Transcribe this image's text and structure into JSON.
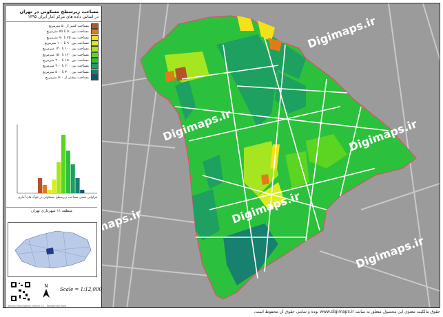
{
  "legend": {
    "title": "مساحت زیرسطح مسکونی در تهران",
    "subtitle": "در اساس داده های مرکز آمار ایران ۱۳۹۵",
    "items": [
      {
        "label": "مساحت کمتر از ۵۰ مترمربع",
        "color": "#b5532b"
      },
      {
        "label": "مساحت بین ۵۰ تا ۷۵ مترمربع",
        "color": "#e07b1a"
      },
      {
        "label": "مساحت بین ۷۵ تا ۹۰ مترمربع",
        "color": "#f4e11a"
      },
      {
        "label": "مساحت بین ۹۰ تا ۱۰۰ مترمربع",
        "color": "#d9ef1d"
      },
      {
        "label": "مساحت بین ۱۰۰ تا ۱۲۰ مترمربع",
        "color": "#a5e620"
      },
      {
        "label": "مساحت بین ۱۲۰ تا ۱۵۰ مترمربع",
        "color": "#5bd522"
      },
      {
        "label": "مساحت بین ۱۵۰ تا ۲۰۰ مترمربع",
        "color": "#2cc13c"
      },
      {
        "label": "مساحت بین ۲۰۰ تا ۳۰۰ مترمربع",
        "color": "#1da060"
      },
      {
        "label": "مساحت بین ۳۰۰ تا ۵۰۰ مترمربع",
        "color": "#17806f"
      },
      {
        "label": "مساحت بیشتر از ۵۰۰ مترمربع",
        "color": "#11527a"
      }
    ],
    "histogram_caption": "فراوانی نسبی مساحت زیرسطح مسکونی در بلوک های آماری",
    "district_label": "منطقه ۱۱ شهرداری تهران"
  },
  "scale": "Scale = 1:12,000",
  "credit": "Tehran Municipality District 11 - Residential Area",
  "watermarks": [
    "Digimaps.ir",
    "Digimaps.ir",
    "Digimaps.ir",
    "Digimaps.ir",
    "Digimaps.ir",
    "Digimaps.ir",
    "Digimaps.ir"
  ],
  "copyright": "حقوق مالکیت معنوی این محصول متعلق به سایت www.digimaps.ir بوده و تمامی حقوق آن محفوظ است.",
  "chart_data": {
    "type": "bar",
    "categories": [
      "<50",
      "50-75",
      "75-90",
      "90-100",
      "100-120",
      "120-150",
      "150-200",
      "200-300",
      "300-500",
      ">500"
    ],
    "values": [
      22,
      12,
      5,
      20,
      45,
      85,
      62,
      42,
      22,
      5
    ],
    "colors": [
      "#b5532b",
      "#e07b1a",
      "#f4e11a",
      "#d9ef1d",
      "#a5e620",
      "#5bd522",
      "#2cc13c",
      "#1da060",
      "#17806f",
      "#11527a"
    ]
  }
}
